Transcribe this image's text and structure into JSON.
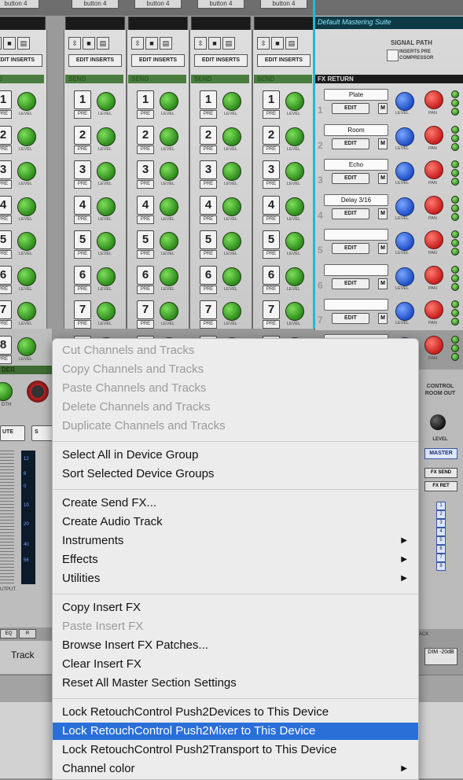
{
  "mixer": {
    "top_buttons": [
      "button 4",
      "button 4",
      "button 4",
      "button 4",
      "button 4"
    ],
    "mastering_suite": "Default Mastering Suite",
    "signal_path": "SIGNAL PATH",
    "inserts_pre_compressor": "INSERTS PRE COMPRESSOR",
    "edit_inserts": "EDIT INSERTS",
    "send_label": "SEND",
    "send_label_first": "END",
    "fx_return": "FX RETURN",
    "pre": "PRE",
    "level": "LEVEL",
    "pan": "PAN",
    "edit": "EDIT",
    "m": "M",
    "send_numbers": [
      "1",
      "2",
      "3",
      "4",
      "5",
      "6",
      "7",
      "8"
    ],
    "fx_returns": [
      "Plate",
      "Room",
      "Echo",
      "Delay 3/16",
      "",
      "",
      "",
      ""
    ],
    "fader_label": "DER",
    "width_label": "DTH",
    "mute_label": "UTE",
    "solo_label": "S",
    "output_label": "UTPUT",
    "meter_ticks": [
      "12",
      "6",
      "0",
      "10",
      "20",
      "40",
      "56"
    ],
    "control_room_out": "CONTROL ROOM OUT",
    "cr_level": "LEVEL",
    "master_btn": "MASTER",
    "fx_send_btn": "FX SEND",
    "fx_ret_btn": "FX RET",
    "cr_channels": [
      "1",
      "2",
      "3",
      "4",
      "5",
      "6",
      "7",
      "8"
    ],
    "track_label": "Track",
    "eq_label": "EQ",
    "r_label": "R",
    "back_label": "ACK",
    "dim_label": "DIM -20dB"
  },
  "context_menu": {
    "groups": [
      [
        {
          "label": "Cut Channels and Tracks",
          "enabled": false
        },
        {
          "label": "Copy Channels and Tracks",
          "enabled": false
        },
        {
          "label": "Paste Channels and Tracks",
          "enabled": false
        },
        {
          "label": "Delete Channels and Tracks",
          "enabled": false
        },
        {
          "label": "Duplicate Channels and Tracks",
          "enabled": false
        }
      ],
      [
        {
          "label": "Select All in Device Group",
          "enabled": true
        },
        {
          "label": "Sort Selected Device Groups",
          "enabled": true
        }
      ],
      [
        {
          "label": "Create Send FX...",
          "enabled": true
        },
        {
          "label": "Create Audio Track",
          "enabled": true
        },
        {
          "label": "Instruments",
          "enabled": true,
          "submenu": true
        },
        {
          "label": "Effects",
          "enabled": true,
          "submenu": true
        },
        {
          "label": "Utilities",
          "enabled": true,
          "submenu": true
        }
      ],
      [
        {
          "label": "Copy Insert FX",
          "enabled": true
        },
        {
          "label": "Paste Insert FX",
          "enabled": false
        },
        {
          "label": "Browse Insert FX Patches...",
          "enabled": true
        },
        {
          "label": "Clear Insert FX",
          "enabled": true
        },
        {
          "label": "Reset All Master Section Settings",
          "enabled": true
        }
      ],
      [
        {
          "label": "Lock RetouchControl Push2Devices to This Device",
          "enabled": true
        },
        {
          "label": "Lock RetouchControl Push2Mixer to This Device",
          "enabled": true,
          "highlighted": true
        },
        {
          "label": "Lock RetouchControl Push2Transport to This Device",
          "enabled": true
        },
        {
          "label": "Channel color",
          "enabled": true,
          "submenu": true
        }
      ]
    ],
    "submenu_arrow": "▶",
    "highlight_color": "#2a6fd8"
  },
  "colors": {
    "fx_return_band": "#1a1a1a",
    "cyan_accent": "#23b8d8",
    "green_knob": "#2e8a1c",
    "blue_knob": "#1f4fc8",
    "red_knob": "#c81f1f"
  }
}
